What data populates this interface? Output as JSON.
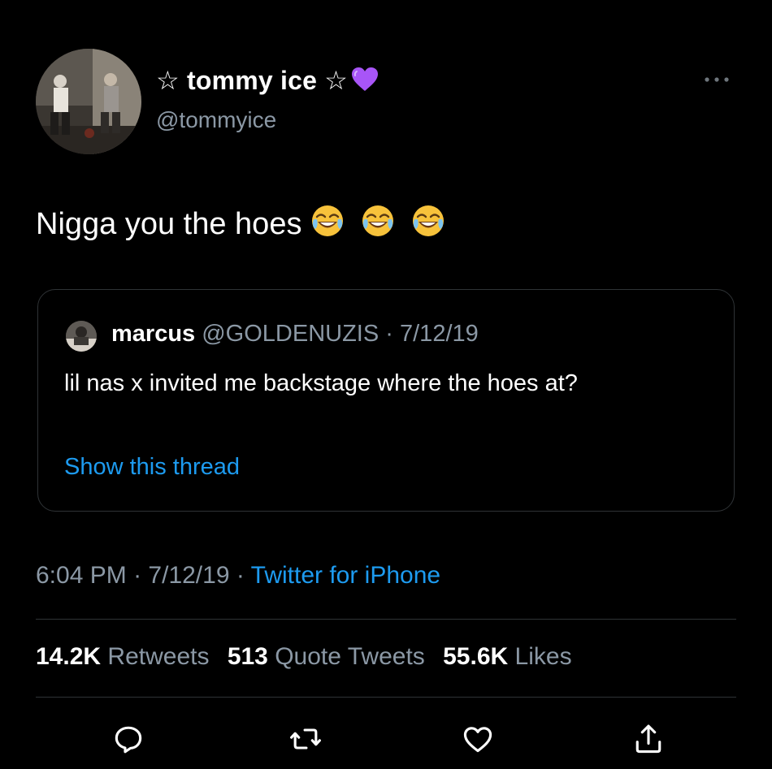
{
  "author": {
    "star_left": "☆",
    "name": "tommy ice",
    "star_right": "☆",
    "handle": "@tommyice"
  },
  "tweet": {
    "text": "Nigga you the hoes",
    "emoji": "face-with-tears-of-joy",
    "emoji_count": 3
  },
  "quote": {
    "name": "marcus",
    "handle": "@GOLDENUZIS",
    "separator": "·",
    "date": "7/12/19",
    "text": "lil nas x invited me backstage where the hoes at?",
    "show_thread": "Show this thread"
  },
  "meta": {
    "time": "6:04 PM",
    "separator": "·",
    "date": "7/12/19",
    "source": "Twitter for iPhone"
  },
  "stats": {
    "retweets_count": "14.2K",
    "retweets_label": "Retweets",
    "quotes_count": "513",
    "quotes_label": "Quote Tweets",
    "likes_count": "55.6K",
    "likes_label": "Likes"
  },
  "icons": {
    "more": "more-horizontal-icon",
    "reply": "reply-icon",
    "retweet": "retweet-icon",
    "like": "heart-icon",
    "share": "share-icon",
    "name_badge": "purple-heart-icon"
  },
  "colors": {
    "background": "#000000",
    "text_primary": "#ffffff",
    "text_secondary": "#8b98a5",
    "link": "#1d9bf0",
    "border": "#2f3336",
    "purple_heart": "#a855f7"
  }
}
